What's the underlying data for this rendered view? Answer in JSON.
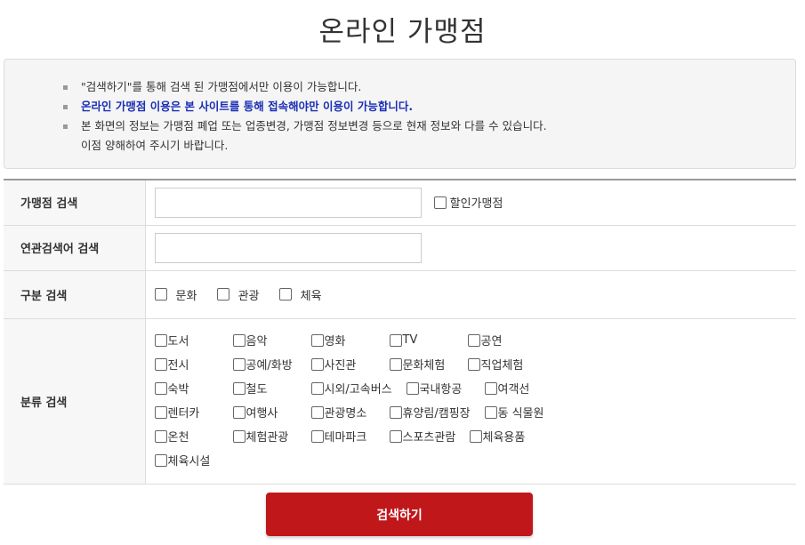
{
  "page_title": "온라인 가맹점",
  "notice": {
    "line1": "\"검색하기\"를 통해 검색 된 가맹점에서만 이용이 가능합니다.",
    "line2": "온라인 가맹점 이용은 본 사이트를 통해 접속해야만 이용이 가능합니다.",
    "line3a": "본 화면의 정보는 가맹점 폐업 또는 업종변경, 가맹점 정보변경 등으로 현재 정보와 다를 수 있습니다.",
    "line3b": "이점 양해하여 주시기 바랍니다.",
    "highlight_color": "#1a2fb5"
  },
  "form": {
    "store_search_label": "가맹점 검색",
    "store_search_value": "",
    "discount_label": "할인가맹점",
    "related_search_label": "연관검색어 검색",
    "related_search_value": "",
    "division_label": "구분 검색",
    "divisions": [
      "문화",
      "관광",
      "체육"
    ],
    "category_label": "분류 검색",
    "categories": [
      [
        "도서",
        "음악",
        "영화",
        "TV",
        "공연"
      ],
      [
        "전시",
        "공예/화방",
        "사진관",
        "문화체험",
        "직업체험"
      ],
      [
        "숙박",
        "철도",
        "시외/고속버스",
        "국내항공",
        "여객선"
      ],
      [
        "렌터카",
        "여행사",
        "관광명소",
        "휴양림/캠핑장",
        "동 식물원"
      ],
      [
        "온천",
        "체험관광",
        "테마파크",
        "스포츠관람",
        "체육용품"
      ],
      [
        "체육시설"
      ]
    ]
  },
  "search_button_label": "검색하기",
  "colors": {
    "button_bg": "#c0171b",
    "notice_bg": "#f5f5f5",
    "label_bg": "#f7f7f7"
  }
}
